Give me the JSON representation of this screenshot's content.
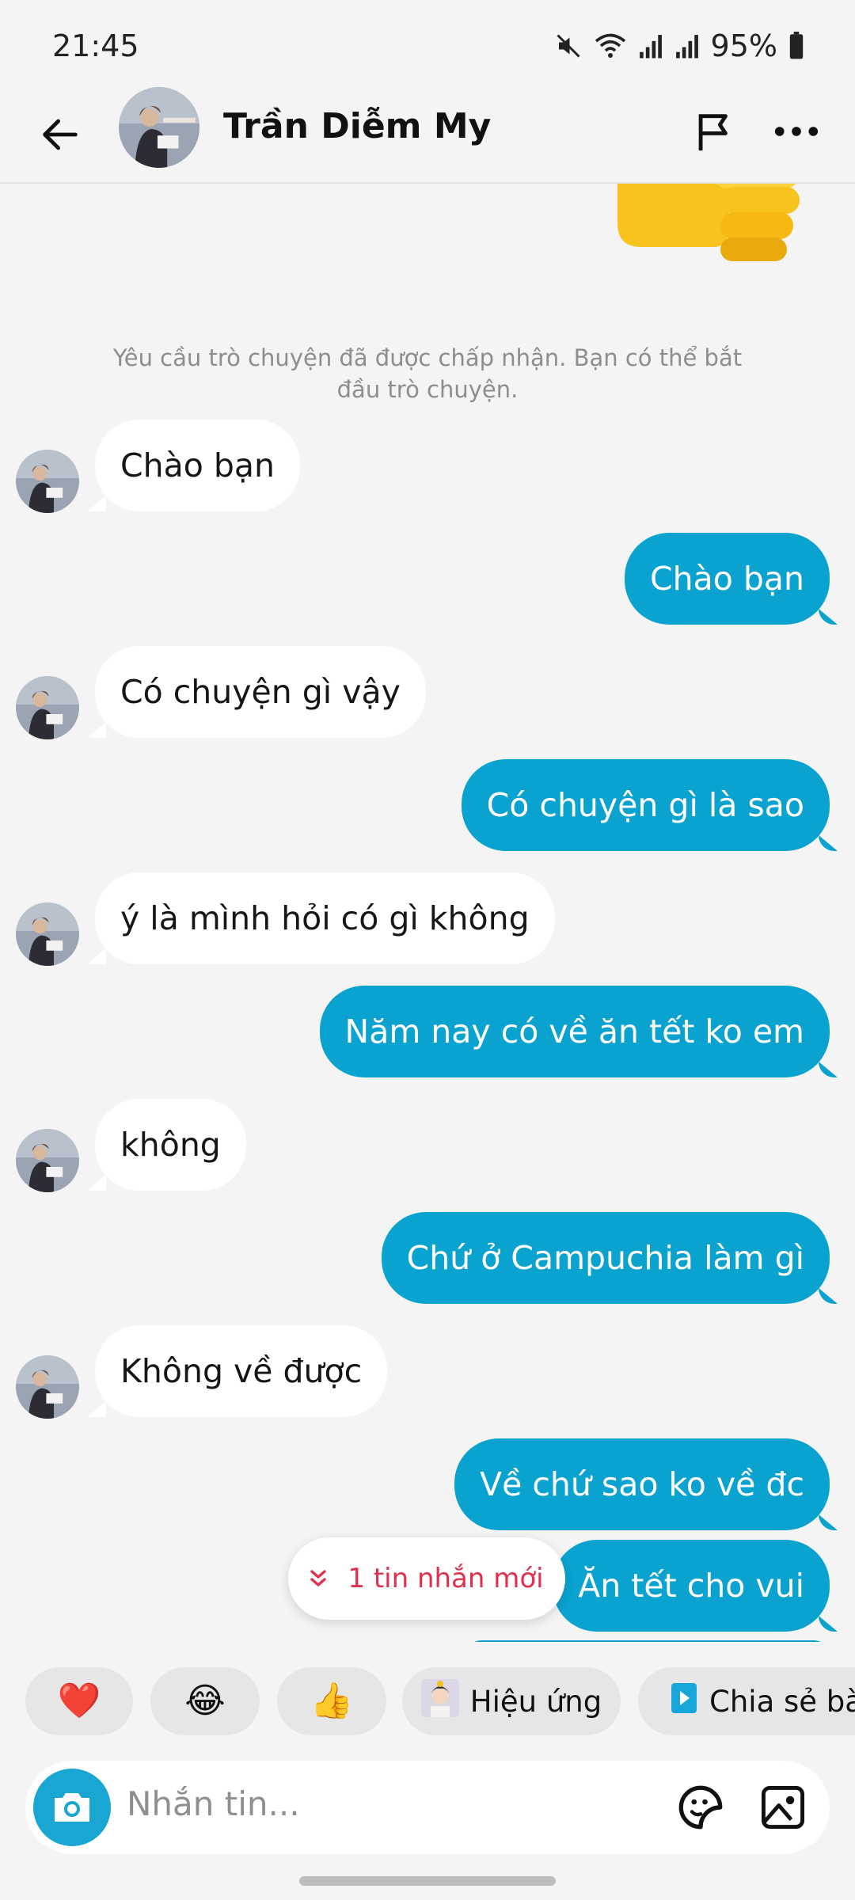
{
  "status_bar": {
    "time": "21:45",
    "battery": "95%",
    "icons": [
      "mute-icon",
      "wifi-icon",
      "signal-icon",
      "signal-icon",
      "battery-icon"
    ]
  },
  "header": {
    "contact_name": "Trần Diễm My",
    "icons": [
      "back-arrow-icon",
      "flag-icon",
      "more-icon"
    ]
  },
  "chat": {
    "system_note": "Yêu cầu trò chuyện đã được chấp nhận. Bạn có thể bắt đầu trò chuyện.",
    "messages": [
      {
        "from": "them",
        "text": "Chào bạn"
      },
      {
        "from": "me",
        "text": "Chào bạn"
      },
      {
        "from": "them",
        "text": "Có chuyện gì vậy"
      },
      {
        "from": "me",
        "text": "Có chuyện gì là sao"
      },
      {
        "from": "them",
        "text": "ý là mình hỏi có gì không"
      },
      {
        "from": "me",
        "text": "Năm nay có về ăn tết ko em"
      },
      {
        "from": "them",
        "text": "không"
      },
      {
        "from": "me",
        "text": "Chứ ở Campuchia làm gì"
      },
      {
        "from": "them",
        "text": "Không về được"
      },
      {
        "from": "me",
        "text": "Về chứ sao ko về đc"
      },
      {
        "from": "me",
        "text": "Ăn tết cho vui"
      }
    ],
    "new_message_pill": "1 tin nhắn mới"
  },
  "quick_bar": {
    "chips": [
      {
        "emoji": "❤️",
        "icon": "heart-icon"
      },
      {
        "emoji": "😂",
        "icon": "laughing-icon"
      },
      {
        "emoji": "👍",
        "icon": "thumbs-up-icon"
      },
      {
        "label": "Hiệu ứng",
        "icon": "effect-avatar-icon"
      },
      {
        "label": "Chia sẻ bà",
        "icon": "share-icon"
      }
    ]
  },
  "input": {
    "placeholder": "Nhắn tin..."
  },
  "colors": {
    "outgoing_bubble": "#0aa3cf",
    "incoming_bubble": "#ffffff",
    "background": "#f4f4f4",
    "accent_red": "#e0304e"
  }
}
